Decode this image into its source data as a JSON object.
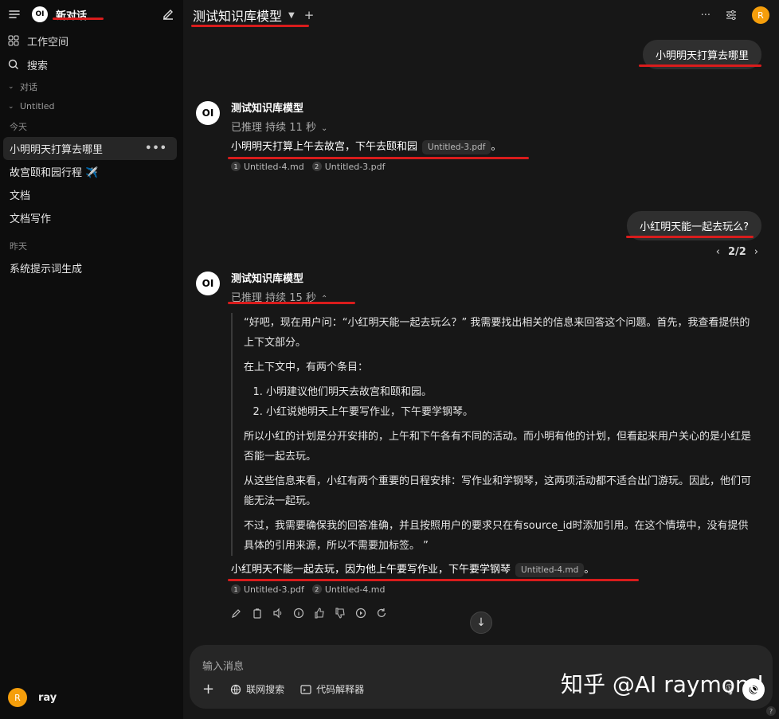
{
  "sidebar": {
    "logo_text": "OI",
    "title": "新对话",
    "workspace_label": "工作空间",
    "search_label": "搜索",
    "section_chats": "对话",
    "section_untitled": "Untitled",
    "date_today": "今天",
    "chats_today": [
      "小明明天打算去哪里",
      "故宫颐和园行程 ✈️",
      "文档",
      "文档写作"
    ],
    "chat_more": "•••",
    "date_yesterday": "昨天",
    "chats_yesterday": [
      "系统提示词生成"
    ],
    "user_initial": "R",
    "user_name": "ray"
  },
  "topbar": {
    "model_name": "测试知识库模型",
    "more": "···",
    "user_initial": "R"
  },
  "conversation": {
    "q1": "小明明天打算去哪里",
    "assistant_name": "测试知识库模型",
    "a1_reasoning": "已推理 持续 11 秒",
    "a1_answer": "小明明天打算上午去故宫，下午去颐和园",
    "a1_cite": "Untitled-3.pdf",
    "a1_end": "。",
    "a1_sources": [
      {
        "num": "1",
        "name": "Untitled-4.md"
      },
      {
        "num": "2",
        "name": "Untitled-3.pdf"
      }
    ],
    "q2": "小红明天能一起去玩么?",
    "pager": "2/2",
    "a2_reasoning": "已推理 持续 15 秒",
    "reasoning_p1": "“好吧，现在用户问：“小红明天能一起去玩么？” 我需要找出相关的信息来回答这个问题。首先，我查看提供的上下文部分。",
    "reasoning_p2": "在上下文中，有两个条目：",
    "reasoning_items": [
      "小明建议他们明天去故宫和颐和园。",
      "小红说她明天上午要写作业，下午要学钢琴。"
    ],
    "reasoning_p3": "所以小红的计划是分开安排的，上午和下午各有不同的活动。而小明有他的计划，但看起来用户关心的是小红是否能一起去玩。",
    "reasoning_p4": "从这些信息来看，小红有两个重要的日程安排：写作业和学钢琴，这两项活动都不适合出门游玩。因此，他们可能无法一起玩。",
    "reasoning_p5": "不过，我需要确保我的回答准确，并且按照用户的要求只在有source_id时添加引用。在这个情境中，没有提供具体的引用来源，所以不需要加标签。 ”",
    "a2_answer": "小红明天不能一起去玩，因为他上午要写作业，下午要学钢琴",
    "a2_cite": "Untitled-4.md",
    "a2_end": "。",
    "a2_sources": [
      {
        "num": "1",
        "name": "Untitled-3.pdf"
      },
      {
        "num": "2",
        "name": "Untitled-4.md"
      }
    ]
  },
  "input": {
    "placeholder": "输入消息",
    "web_search": "联网搜索",
    "code_interpreter": "代码解释器"
  },
  "watermark": "知乎 @AI raymond",
  "colors": {
    "accent_red": "#d91c1c",
    "avatar": "#f59e0b"
  }
}
